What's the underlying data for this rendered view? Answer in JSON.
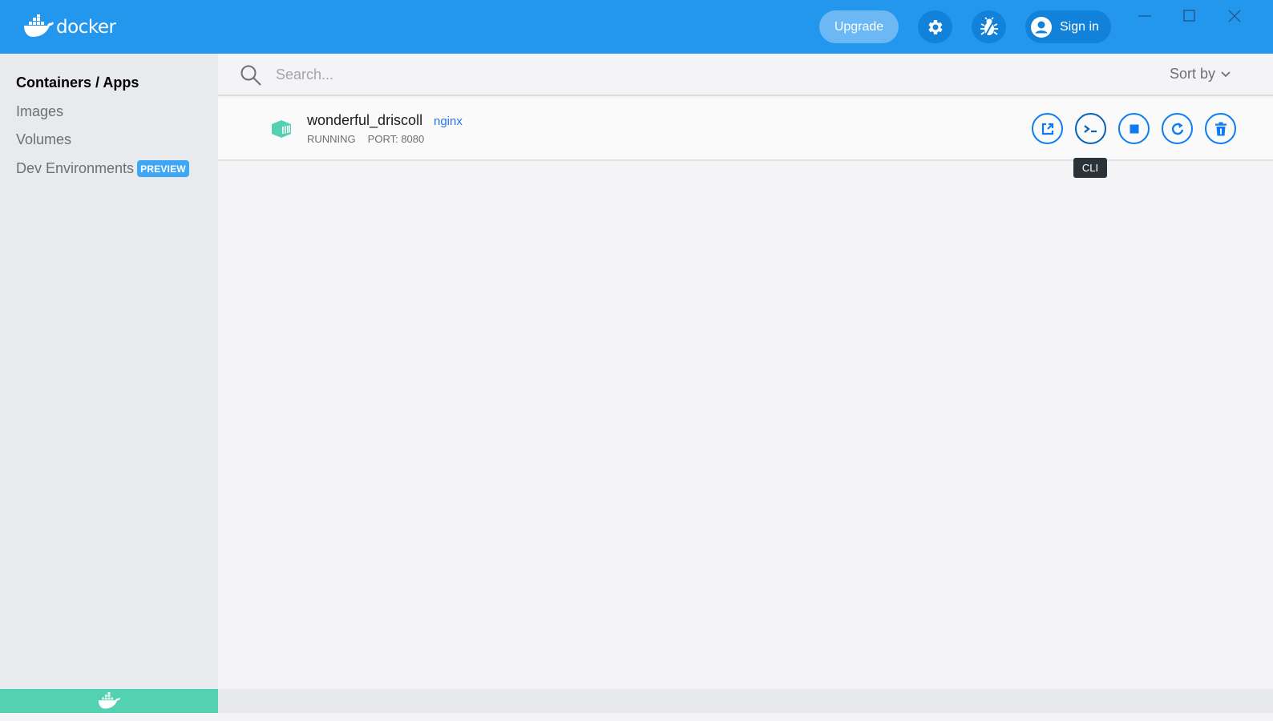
{
  "titlebar": {
    "logo_text": "docker",
    "upgrade_label": "Upgrade",
    "settings_icon": "gear-icon",
    "troubleshoot_icon": "bug-icon",
    "signin_label": "Sign in",
    "window_controls": [
      "minimize",
      "maximize",
      "close"
    ]
  },
  "sidebar": {
    "items": [
      {
        "label": "Containers / Apps",
        "active": true
      },
      {
        "label": "Images",
        "active": false
      },
      {
        "label": "Volumes",
        "active": false
      },
      {
        "label": "Dev Environments",
        "active": false,
        "badge": "PREVIEW"
      }
    ],
    "status_color": "#53d1b1"
  },
  "main": {
    "search": {
      "placeholder": "Search...",
      "value": ""
    },
    "sort_label": "Sort by",
    "containers": [
      {
        "name": "wonderful_driscoll",
        "image": "nginx",
        "status": "RUNNING",
        "port": "PORT: 8080",
        "status_color": "#53d1b1",
        "actions": [
          {
            "name": "open-in-browser",
            "icon": "external-link-icon"
          },
          {
            "name": "cli",
            "icon": "terminal-icon"
          },
          {
            "name": "stop",
            "icon": "stop-icon"
          },
          {
            "name": "restart",
            "icon": "restart-icon"
          },
          {
            "name": "delete",
            "icon": "trash-icon"
          }
        ]
      }
    ],
    "tooltip": "CLI"
  },
  "colors": {
    "brand": "#2396ed",
    "action": "#0d7cf2",
    "link": "#2677e8"
  }
}
